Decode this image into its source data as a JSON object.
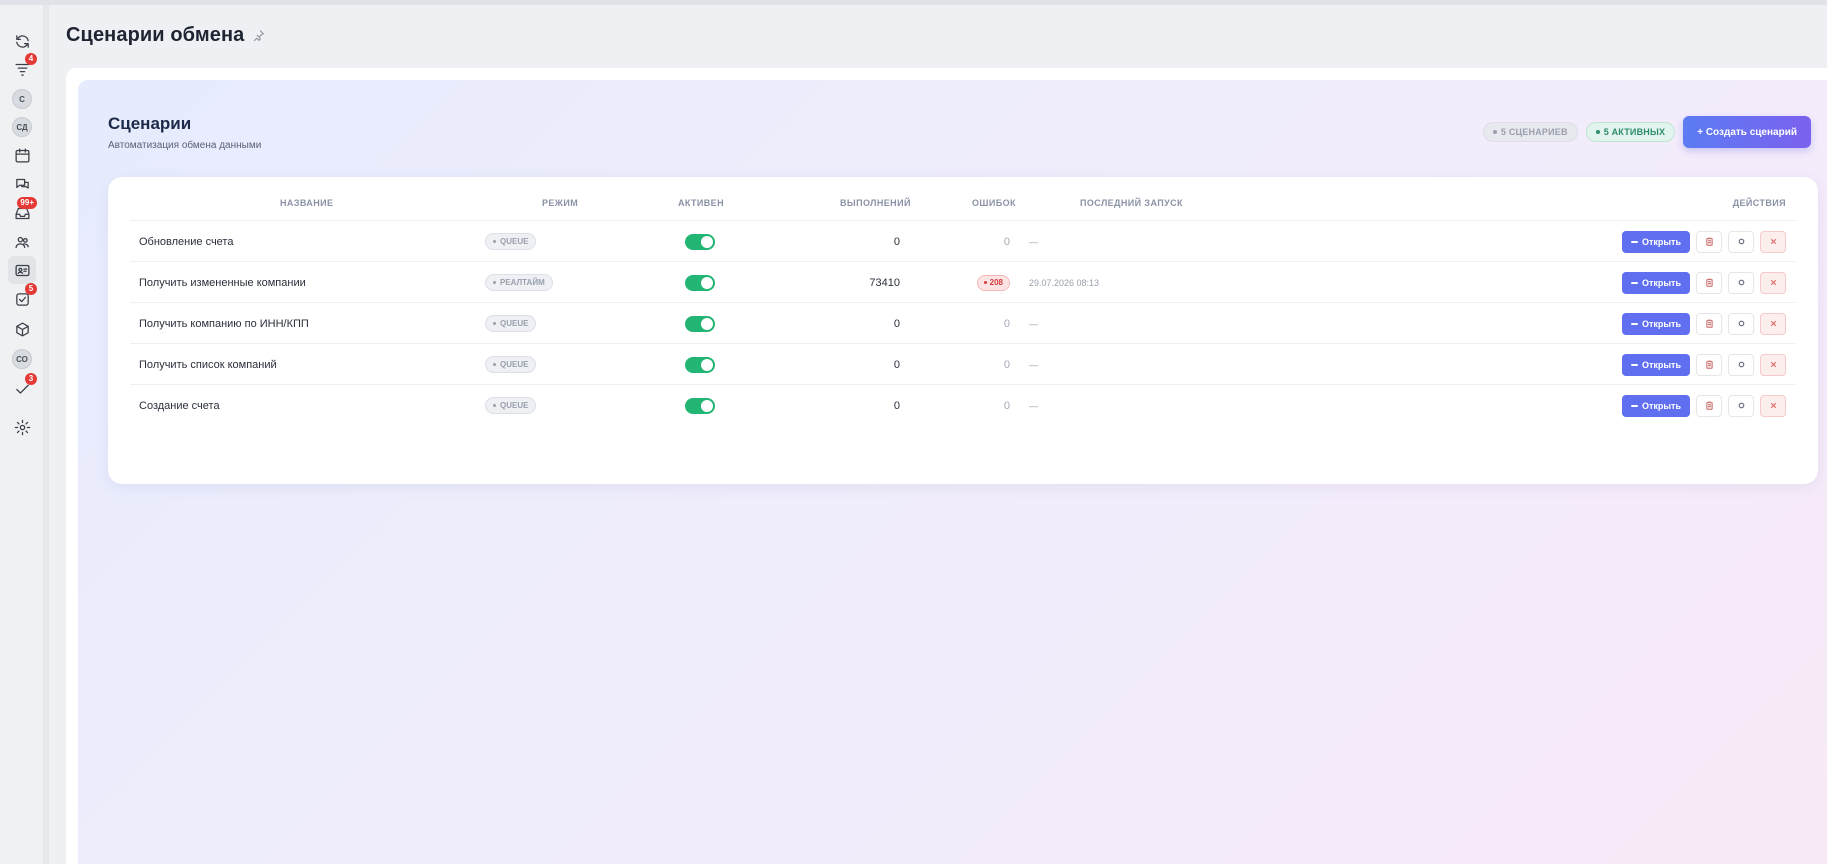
{
  "page": {
    "title": "Сценарии обмена"
  },
  "sidebar": {
    "items": [
      {
        "type": "icon",
        "icon": "refresh-icon",
        "badge": ""
      },
      {
        "type": "icon",
        "icon": "filter-icon",
        "badge": "4"
      },
      {
        "type": "avatar",
        "initials": "С",
        "badge": ""
      },
      {
        "type": "avatar",
        "initials": "СД",
        "badge": ""
      },
      {
        "type": "icon",
        "icon": "calendar-icon",
        "badge": ""
      },
      {
        "type": "icon",
        "icon": "chat-icon",
        "badge": ""
      },
      {
        "type": "icon",
        "icon": "inbox-icon",
        "badge": "99+"
      },
      {
        "type": "icon",
        "icon": "users-icon",
        "badge": ""
      },
      {
        "type": "icon",
        "icon": "id-card-icon",
        "badge": ""
      },
      {
        "type": "icon",
        "icon": "task-check-icon",
        "badge": "5"
      },
      {
        "type": "icon",
        "icon": "cube-icon",
        "badge": ""
      },
      {
        "type": "avatar",
        "initials": "СО",
        "badge": ""
      },
      {
        "type": "icon",
        "icon": "checkmark-icon",
        "badge": "3"
      },
      {
        "type": "icon",
        "icon": "gear-icon",
        "badge": ""
      }
    ]
  },
  "scenarios": {
    "title": "Сценарии",
    "subtitle": "Автоматизация обмена данными",
    "count_pill": "5 СЦЕНАРИЕВ",
    "active_pill": "5 АКТИВНЫХ",
    "create_button": "+ Создать сценарий"
  },
  "table": {
    "headers": {
      "name": "НАЗВАНИЕ",
      "mode": "РЕЖИМ",
      "active": "АКТИВЕН",
      "runs": "ВЫПОЛНЕНИЙ",
      "errors": "ОШИБОК",
      "last_run": "ПОСЛЕДНИЙ ЗАПУСК",
      "actions": "ДЕЙСТВИЯ"
    },
    "open_label": "Открыть",
    "rows": [
      {
        "name": "Обновление счета",
        "mode": "QUEUE",
        "active": true,
        "runs": "0",
        "errors": "0",
        "error_badge": false,
        "last_run": "—"
      },
      {
        "name": "Получить измененные компании",
        "mode": "РЕАЛТАЙМ",
        "active": true,
        "runs": "73410",
        "errors": "208",
        "error_badge": true,
        "last_run": "29.07.2026 08:13"
      },
      {
        "name": "Получить компанию по ИНН/КПП",
        "mode": "QUEUE",
        "active": true,
        "runs": "0",
        "errors": "0",
        "error_badge": false,
        "last_run": "—"
      },
      {
        "name": "Получить список компаний",
        "mode": "QUEUE",
        "active": true,
        "runs": "0",
        "errors": "0",
        "error_badge": false,
        "last_run": "—"
      },
      {
        "name": "Создание счета",
        "mode": "QUEUE",
        "active": true,
        "runs": "0",
        "errors": "0",
        "error_badge": false,
        "last_run": "—"
      }
    ]
  },
  "colors": {
    "accent": "#5f6ff0",
    "toggle_on": "#22b573",
    "error": "#d63b3b",
    "badge": "#e53935"
  }
}
